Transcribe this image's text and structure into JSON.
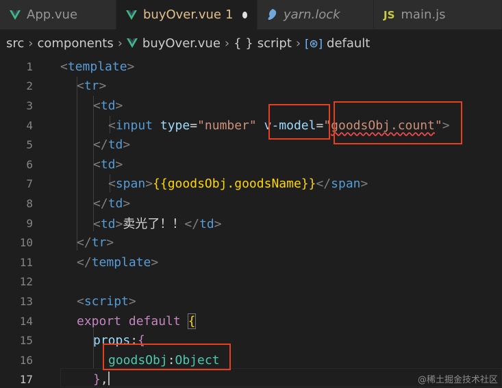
{
  "tabs": [
    {
      "label": "App.vue",
      "icon": "vue-icon"
    },
    {
      "label": "buyOver.vue",
      "badge": "1",
      "icon": "vue-icon",
      "active": true
    },
    {
      "label": "yarn.lock",
      "icon": "yarn-icon"
    },
    {
      "label": "main.js",
      "icon": "js-icon",
      "icon_text": "JS"
    }
  ],
  "breadcrumb": {
    "src": "src",
    "components": "components",
    "file": "buyOver.vue",
    "script_icon": "{ }",
    "script": "script",
    "default_icon": "[⊛]",
    "default": "default"
  },
  "lines": [
    "1",
    "2",
    "3",
    "4",
    "5",
    "6",
    "7",
    "8",
    "9",
    "10",
    "11",
    "12",
    "13",
    "14",
    "15",
    "16",
    "17"
  ],
  "code": {
    "l1_tag": "template",
    "l2_tag": "tr",
    "l3_tag": "td",
    "l4_tag": "input",
    "l4_attr_type": "type",
    "l4_val_type": "\"number\"",
    "l4_attr_vmodel": "v-model",
    "l4_val_vmodel": "goodsObj.count",
    "l5_tag": "td",
    "l6_tag": "td",
    "l7_tag": "span",
    "l7_expr": "{{goodsObj.goodsName}}",
    "l8_tag": "td",
    "l9_tag": "td",
    "l9_text": "卖光了！！",
    "l10_tag": "tr",
    "l11_tag": "template",
    "l13_tag": "script",
    "l14_export": "export",
    "l14_default": "default",
    "l15_props": "props",
    "l16_key": "goodsObj",
    "l16_type": "Object"
  },
  "watermark": "@稀土掘金技术社区",
  "colors": {
    "accent_box": "#e8401c",
    "vue": "#42b883",
    "active_tab_text": "#e2c08d"
  }
}
